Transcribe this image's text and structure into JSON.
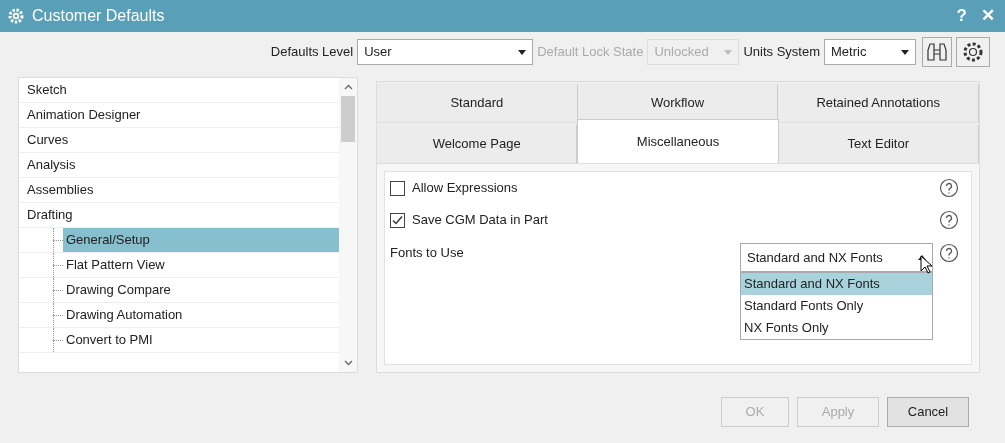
{
  "window": {
    "title": "Customer Defaults",
    "help": "?",
    "close": "✕"
  },
  "toolbar": [
    {
      "label": "Defaults Level",
      "value": "User",
      "disabled": false
    },
    {
      "label": "Default Lock State",
      "value": "Unlocked",
      "disabled": true
    },
    {
      "label": "Units System",
      "value": "Metric",
      "disabled": false
    }
  ],
  "tree": [
    {
      "label": "Sketch",
      "selected": false
    },
    {
      "label": "Animation Designer",
      "selected": false
    },
    {
      "label": "Curves",
      "selected": false
    },
    {
      "label": "Analysis",
      "selected": false
    },
    {
      "label": "Assemblies",
      "selected": false
    },
    {
      "label": "Drafting",
      "selected": false,
      "children": [
        {
          "label": "General/Setup",
          "selected": true
        },
        {
          "label": "Flat Pattern View",
          "selected": false
        },
        {
          "label": "Drawing Compare",
          "selected": false
        },
        {
          "label": "Drawing Automation",
          "selected": false
        },
        {
          "label": "Convert to PMI",
          "selected": false
        }
      ]
    }
  ],
  "tab_rows": [
    [
      {
        "label": "Standard",
        "selected": false
      },
      {
        "label": "Workflow",
        "selected": false
      },
      {
        "label": "Retained Annotations",
        "selected": false
      }
    ],
    [
      {
        "label": "Welcome Page",
        "selected": false
      },
      {
        "label": "Miscellaneous",
        "selected": true
      },
      {
        "label": "Text Editor",
        "selected": false
      }
    ]
  ],
  "options": [
    {
      "kind": "checkbox",
      "label": "Allow Expressions",
      "checked": false
    },
    {
      "kind": "checkbox",
      "label": "Save CGM Data in Part",
      "checked": true
    },
    {
      "kind": "dropdown",
      "label": "Fonts to Use",
      "value": "Standard and NX Fonts",
      "expanded": true,
      "choices": [
        {
          "label": "Standard and NX Fonts",
          "selected": true
        },
        {
          "label": "Standard Fonts Only",
          "selected": false
        },
        {
          "label": "NX Fonts Only",
          "selected": false
        }
      ]
    }
  ],
  "buttons": [
    {
      "label": "OK",
      "disabled": true
    },
    {
      "label": "Apply",
      "disabled": true
    },
    {
      "label": "Cancel",
      "disabled": false
    }
  ]
}
